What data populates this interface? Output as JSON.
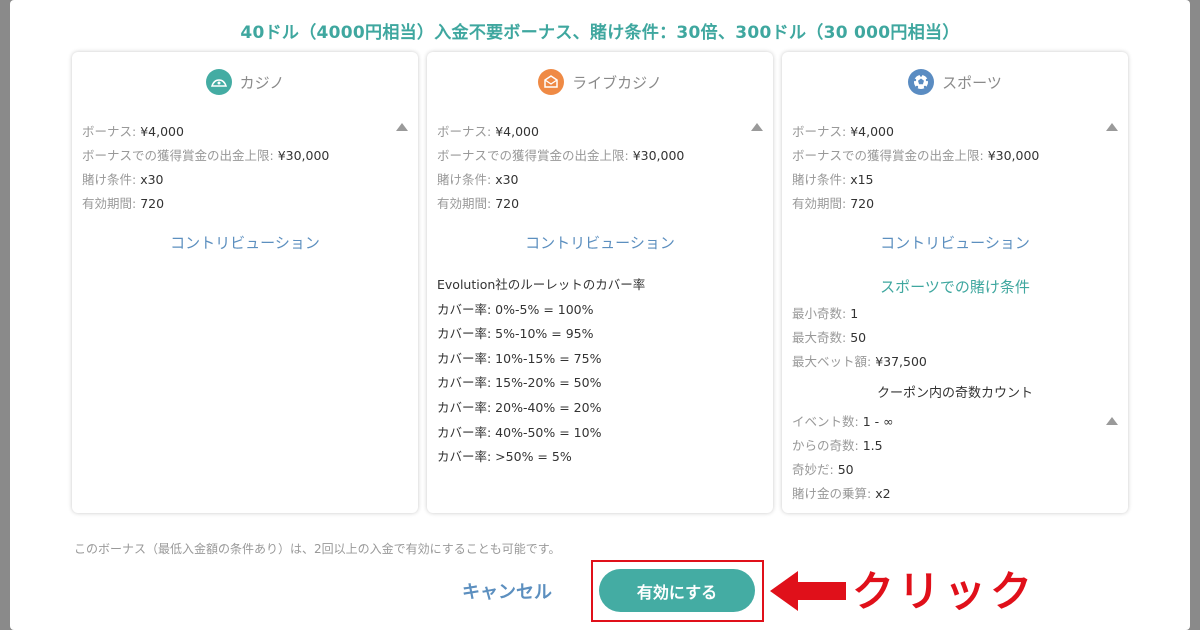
{
  "title": "40ドル（4000円相当）入金不要ボーナス、賭け条件：30倍、300ドル（30 000円相当）",
  "colors": {
    "accent": "#3fa79f",
    "link": "#5c8fbf",
    "casino_icon": "#44aca3",
    "live_icon": "#ef8a45",
    "sports_icon": "#5a8cc2",
    "highlight": "#e0101a"
  },
  "cards": [
    {
      "label": "カジノ",
      "icon": "casino-icon",
      "rows": [
        {
          "k": "ボーナス: ",
          "v": "¥4,000"
        },
        {
          "k": "ボーナスでの獲得賞金の出金上限: ",
          "v": "¥30,000"
        },
        {
          "k": "賭け条件: ",
          "v": "x30"
        },
        {
          "k": "有効期間: ",
          "v": "720"
        }
      ],
      "contribution_label": "コントリビューション"
    },
    {
      "label": "ライブカジノ",
      "icon": "live-casino-icon",
      "rows": [
        {
          "k": "ボーナス: ",
          "v": "¥4,000"
        },
        {
          "k": "ボーナスでの獲得賞金の出金上限: ",
          "v": "¥30,000"
        },
        {
          "k": "賭け条件: ",
          "v": "x30"
        },
        {
          "k": "有効期間: ",
          "v": "720"
        }
      ],
      "contribution_label": "コントリビューション",
      "coverage_heading": "Evolution社のルーレットのカバー率",
      "coverage": [
        "カバー率: 0%-5% = 100%",
        "カバー率: 5%-10% = 95%",
        "カバー率: 10%-15% = 75%",
        "カバー率: 15%-20% = 50%",
        "カバー率: 20%-40% = 20%",
        "カバー率: 40%-50% = 10%",
        "カバー率: >50% = 5%"
      ]
    },
    {
      "label": "スポーツ",
      "icon": "sports-icon",
      "rows": [
        {
          "k": "ボーナス: ",
          "v": "¥4,000"
        },
        {
          "k": "ボーナスでの獲得賞金の出金上限: ",
          "v": "¥30,000"
        },
        {
          "k": "賭け条件: ",
          "v": "x15"
        },
        {
          "k": "有効期間: ",
          "v": "720"
        }
      ],
      "contribution_label": "コントリビューション",
      "sports_terms_label": "スポーツでの賭け条件",
      "sports_rows": [
        {
          "k": "最小奇数: ",
          "v": "1"
        },
        {
          "k": "最大奇数: ",
          "v": "50"
        },
        {
          "k": "最大ベット額: ",
          "v": "¥37,500"
        }
      ],
      "coupon_heading": "クーポン内の奇数カウント",
      "coupon_rows": [
        {
          "k": "イベント数: ",
          "v": "1 - ∞"
        },
        {
          "k": "からの奇数: ",
          "v": "1.5"
        },
        {
          "k": "奇妙だ: ",
          "v": "50"
        },
        {
          "k": "賭け金の乗算: ",
          "v": "x2"
        }
      ]
    }
  ],
  "footnote": "このボーナス（最低入金額の条件あり）は、2回以上の入金で有効にすることも可能です。",
  "buttons": {
    "cancel": "キャンセル",
    "activate": "有効にする"
  },
  "annotation": {
    "text": "クリック",
    "arrow": "left-arrow-icon"
  }
}
